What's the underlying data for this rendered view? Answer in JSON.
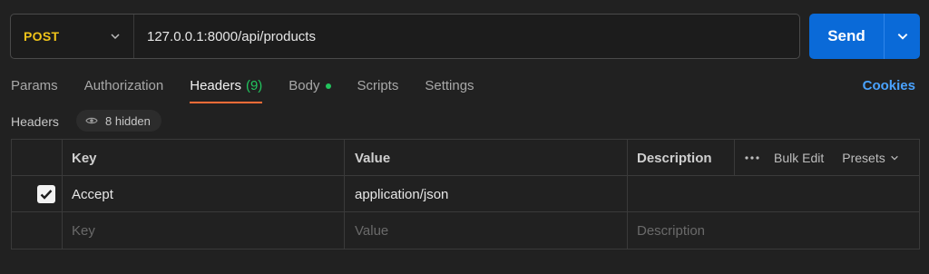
{
  "request": {
    "method": "POST",
    "url": "127.0.0.1:8000/api/products",
    "send_label": "Send"
  },
  "tabs": [
    {
      "label": "Params"
    },
    {
      "label": "Authorization"
    },
    {
      "label": "Headers",
      "count": "(9)"
    },
    {
      "label": "Body"
    },
    {
      "label": "Scripts"
    },
    {
      "label": "Settings"
    }
  ],
  "cookies_label": "Cookies",
  "headers_section": {
    "title": "Headers",
    "hidden_label": "8 hidden"
  },
  "table": {
    "columns": {
      "key": "Key",
      "value": "Value",
      "description": "Description"
    },
    "bulk_edit": "Bulk Edit",
    "presets": "Presets",
    "rows": [
      {
        "checked": true,
        "key": "Accept",
        "value": "application/json",
        "description": ""
      }
    ],
    "placeholders": {
      "key": "Key",
      "value": "Value",
      "description": "Description"
    }
  },
  "colors": {
    "accent_send": "#0a6ad8",
    "method_post": "#f0c419",
    "active_tab_underline": "#ff6c37",
    "header_count": "#22c55e",
    "cookies_link": "#4aa3ff"
  }
}
